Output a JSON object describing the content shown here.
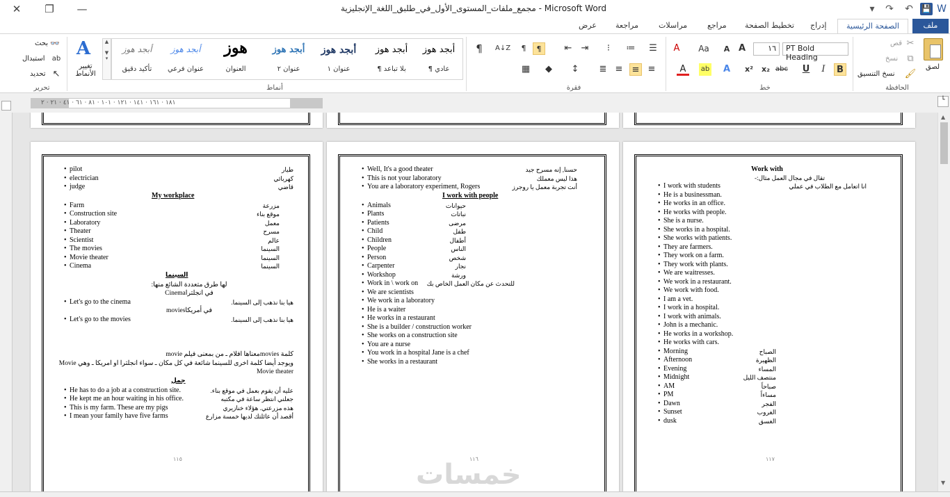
{
  "window": {
    "title": "مجمع_ملفات_المستوى_الأول_في_طلبق_اللغة_الإنجليزية  -  Microsoft Word",
    "controls": {
      "close": "✕",
      "restore": "❐",
      "minimize": "—"
    },
    "qat": {
      "save": "💾",
      "undo": "↶",
      "redo": "↷",
      "customize": "▾"
    }
  },
  "tabs": {
    "file": "ملف",
    "home": "الصفحة الرئيسية",
    "insert": "إدراج",
    "layout": "تخطيط الصفحة",
    "references": "مراجع",
    "mailings": "مراسلات",
    "review": "مراجعة",
    "view": "عرض",
    "help": "?",
    "collapse": "⌃"
  },
  "ribbon": {
    "clipboard": {
      "label": "الحافظة",
      "paste": "لصق",
      "cut": "قص",
      "copy": "نسخ",
      "format_painter": "نسخ التنسيق"
    },
    "font": {
      "label": "خط",
      "font_name": "PT Bold Heading",
      "font_size": "١٦",
      "grow": "A",
      "shrink": "A",
      "change_case": "Aa",
      "clear": "A",
      "bold": "B",
      "italic": "I",
      "underline": "U",
      "strike": "abc",
      "subscript": "x₂",
      "superscript": "x²",
      "text_effects": "A",
      "highlight": "ab",
      "font_color": "A"
    },
    "paragraph": {
      "label": "فقرة",
      "rtl_mark": "¶",
      "ltr_mark": "¶",
      "sort": "A↓Z",
      "show_marks": "¶"
    },
    "styles": {
      "label": "أنماط",
      "change_styles": "تغيير الأنماط",
      "items": [
        {
          "sample": "أبجد هوز",
          "name": "¶ عادي"
        },
        {
          "sample": "أبجد هوز",
          "name": "¶ بلا تباعد"
        },
        {
          "sample": "أبجد هوز",
          "name": "عنوان ١"
        },
        {
          "sample": "أبجد هوز",
          "name": "عنوان ٢"
        },
        {
          "sample": "هوز",
          "name": "العنوان"
        },
        {
          "sample": "أبجد هوز",
          "name": "عنوان فرعي"
        },
        {
          "sample": "أبجد هوز",
          "name": "تأكيد دقيق"
        }
      ]
    },
    "editing": {
      "label": "تحرير",
      "find": "بحث",
      "replace": "استبدال",
      "select": "تحديد"
    }
  },
  "ruler": {
    "text": "١٨١ · ١٦١ · ١٤١ · ١٢١ · ١٠١ · ٨١ · ٦١ · ٤١ · ٢١ · ٢"
  },
  "pages": {
    "left": {
      "num": "١١٥",
      "top_items": [
        {
          "en": "pilot",
          "ar": "طيار"
        },
        {
          "en": "electrician",
          "ar": "كهربائي"
        },
        {
          "en": "judge",
          "ar": "قاضي"
        }
      ],
      "heading1": "My workplace",
      "items": [
        {
          "en": "Farm",
          "ar": "مزرعة"
        },
        {
          "en": "Construction site",
          "ar": "موقع بناء"
        },
        {
          "en": "Laboratory",
          "ar": "معمل"
        },
        {
          "en": "Theater",
          "ar": "مسرح"
        },
        {
          "en": "Scientist",
          "ar": "عالم"
        },
        {
          "en": "The movies",
          "ar": "السينما"
        },
        {
          "en": "Movie theater",
          "ar": "السينما"
        },
        {
          "en": "Cinema",
          "ar": "السينما"
        }
      ],
      "heading2": "السينما",
      "line1": "لها طرق متعددة الشائع منها:",
      "line2": "في انجلتراCinema",
      "cinema_phrase": {
        "en": "Let's go to the cinema",
        "ar": "هيا بنا نذهب إلى السينما."
      },
      "line3": "في أمريكاmovies",
      "movies_phrase": {
        "en": "Let's go to the movies",
        "ar": "هيا بنا نذهب إلى السينما."
      },
      "para1": "كلمة moviesمعناها افلام ـ من بمعنى فيلم  movie",
      "para2": "ويوجد أيضا كلمة اخرى للسينما شائعة في كل مكان ـ سواء انجلترا او امريكا ـ وهي Movie",
      "para3": "Movie theater",
      "heading3": "جمل",
      "sentences": [
        {
          "en": "He has to do a job at a construction site.",
          "ar": "عليه أن يقوم بعمل في موقع بناء."
        },
        {
          "en": "He kept me an hour waiting in his office.",
          "ar": "جعلني انتظر ساعة في مكتبه"
        },
        {
          "en": "This is my farm. These are my pigs",
          "ar": "هذه مزرعتي. هؤلاء خنازيري"
        },
        {
          "en": "I mean your family have five farms",
          "ar": "أقصد أن عائلتك لديها خمسة مزارع"
        }
      ]
    },
    "middle": {
      "num": "١١٦",
      "top_items": [
        {
          "en": "Well, It's a good theater",
          "ar": "حسنا, إنه مسرح جيد"
        },
        {
          "en": "This is not your laboratory",
          "ar": "هذا ليس معملك"
        },
        {
          "en": "You are a laboratory experiment, Rogers",
          "ar": "أنت تجربة معمل يا روجرز"
        }
      ],
      "heading1": "I work with people",
      "items": [
        {
          "en": "Animals",
          "ar": "حيوانات"
        },
        {
          "en": "Plants",
          "ar": "نباتات"
        },
        {
          "en": "Patients",
          "ar": "مرضى"
        },
        {
          "en": "Child",
          "ar": "طفل"
        },
        {
          "en": "Children",
          "ar": "أطفال"
        },
        {
          "en": "People",
          "ar": "الناس"
        },
        {
          "en": "Person",
          "ar": "شخص"
        },
        {
          "en": "Carpenter",
          "ar": "نجار"
        },
        {
          "en": "Workshop",
          "ar": "ورشة"
        },
        {
          "en": "Work in \\ work on",
          "ar": "للتحدث عن مكان العمل الخاص بك"
        },
        {
          "en": "We are scientists",
          "ar": ""
        },
        {
          "en": "We work in a laboratory",
          "ar": ""
        },
        {
          "en": "He is a waiter",
          "ar": ""
        },
        {
          "en": "He works in a restaurant",
          "ar": ""
        },
        {
          "en": "She is a builder / construction worker",
          "ar": ""
        },
        {
          "en": "She works on a construction site",
          "ar": ""
        },
        {
          "en": "You are a nurse",
          "ar": ""
        },
        {
          "en": "You work in a hospital Jane is a chef",
          "ar": ""
        },
        {
          "en": "She works in a restaurant",
          "ar": ""
        }
      ]
    },
    "right": {
      "num": "١١٧",
      "heading1": "Work with",
      "subline": "تقال في مجال العمل مثال:-",
      "first": {
        "en": "I work with students",
        "ar": "انا اتعامل مع الطلاب في عملي"
      },
      "items": [
        "He is a businessman.",
        "He works in an office.",
        "He works with people.",
        "She is a nurse.",
        "She works in a hospital.",
        "She works with patients.",
        "They are farmers.",
        "They work on a farm.",
        "They work with plants.",
        "We are waitresses.",
        "We work in a restaurant.",
        "We work with food.",
        "I am a vet.",
        "I work in a hospital.",
        "I work with animals.",
        "John is a mechanic.",
        "He works in a workshop.",
        "He works with cars."
      ],
      "times": [
        {
          "en": "Morning",
          "ar": "الصباح"
        },
        {
          "en": "Afternoon",
          "ar": "الظهيرة"
        },
        {
          "en": "Evening",
          "ar": "المساء"
        },
        {
          "en": "Midnight",
          "ar": "منتصف الليل"
        },
        {
          "en": "AM",
          "ar": "صباحاً"
        },
        {
          "en": "PM",
          "ar": "مساءاً"
        },
        {
          "en": "Dawn",
          "ar": "الفجر"
        },
        {
          "en": "Sunset",
          "ar": "الغروب"
        },
        {
          "en": "dusk",
          "ar": "الغسق"
        }
      ]
    }
  },
  "watermark": "خمسات"
}
